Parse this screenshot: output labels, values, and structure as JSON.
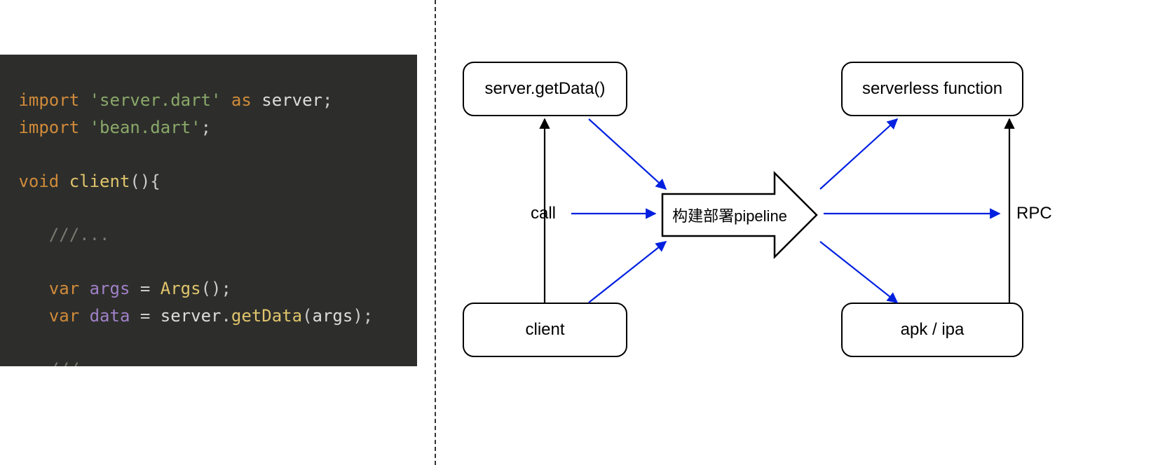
{
  "code": {
    "line1_import": "import",
    "line1_str": "'server.dart'",
    "line1_as": "as",
    "line1_alias": "server",
    "line2_import": "import",
    "line2_str": "'bean.dart'",
    "line4_void": "void",
    "line4_fn": "client",
    "line6_comment": "///...",
    "line8_var": "var",
    "line8_id": "args",
    "line8_ctor": "Args",
    "line9_var": "var",
    "line9_id": "data",
    "line9_obj": "server",
    "line9_method": "getData",
    "line9_arg": "args",
    "line11_comment": "///..."
  },
  "diagram": {
    "box_server_getdata": "server.getData()",
    "box_client": "client",
    "box_serverless": "serverless function",
    "box_apk_ipa": "apk / ipa",
    "label_call": "call",
    "label_rpc": "RPC",
    "big_arrow_label": "构建部署pipeline"
  }
}
